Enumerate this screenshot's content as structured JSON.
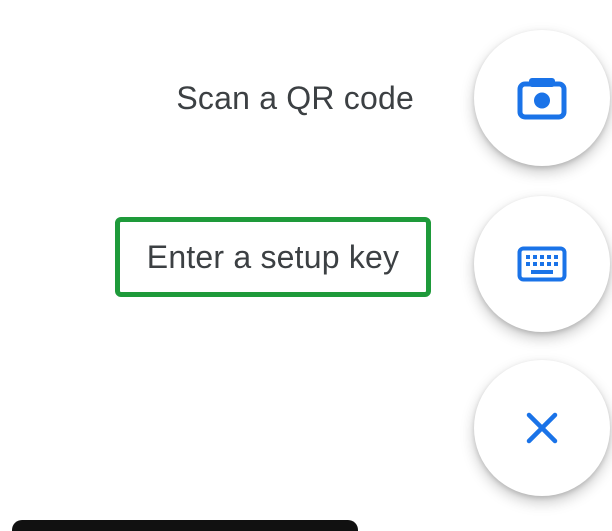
{
  "menu": {
    "scan_label": "Scan a QR code",
    "setup_key_label": "Enter a setup key"
  },
  "icons": {
    "camera": "camera-icon",
    "keyboard": "keyboard-icon",
    "close": "close-icon"
  },
  "colors": {
    "accent_blue": "#1a73e8",
    "highlight_green": "#1e9a3a",
    "label_text": "#3c4043",
    "background": "#ffffff"
  }
}
